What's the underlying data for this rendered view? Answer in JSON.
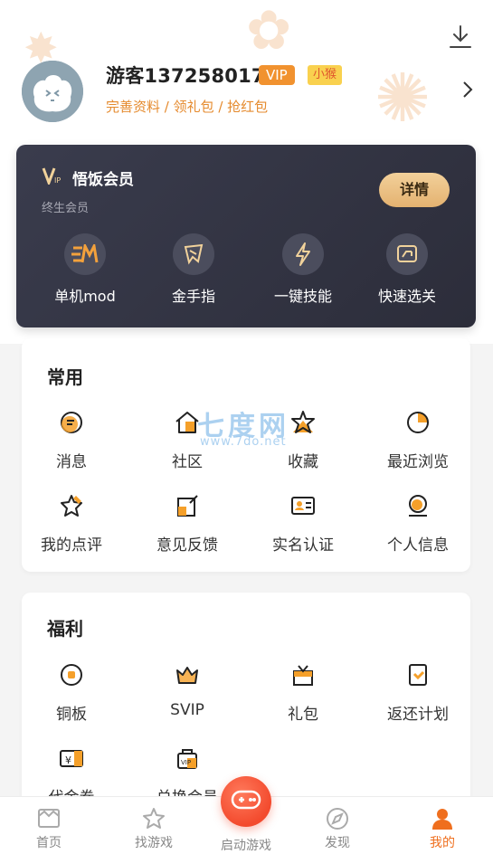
{
  "profile": {
    "username": "游客137258017",
    "vip_badge": "VIP",
    "level_badge": "小猴",
    "links": "完善资料 / 领礼包 / 抢红包"
  },
  "vip_card": {
    "title": "悟饭会员",
    "subtitle": "终生会员",
    "detail_button": "详情",
    "features": [
      {
        "label": "单机mod",
        "icon": "mod-icon"
      },
      {
        "label": "金手指",
        "icon": "cheat-icon"
      },
      {
        "label": "一键技能",
        "icon": "lightning-icon"
      },
      {
        "label": "快速选关",
        "icon": "level-select-icon"
      }
    ]
  },
  "common": {
    "title": "常用",
    "items": [
      {
        "label": "消息",
        "icon": "message-icon"
      },
      {
        "label": "社区",
        "icon": "community-icon"
      },
      {
        "label": "收藏",
        "icon": "star-icon"
      },
      {
        "label": "最近浏览",
        "icon": "history-icon"
      },
      {
        "label": "我的点评",
        "icon": "review-icon"
      },
      {
        "label": "意见反馈",
        "icon": "feedback-icon"
      },
      {
        "label": "实名认证",
        "icon": "id-card-icon"
      },
      {
        "label": "个人信息",
        "icon": "person-info-icon"
      }
    ]
  },
  "welfare": {
    "title": "福利",
    "items": [
      {
        "label": "铜板",
        "icon": "coin-icon"
      },
      {
        "label": "SVIP",
        "icon": "crown-icon"
      },
      {
        "label": "礼包",
        "icon": "gift-icon"
      },
      {
        "label": "返还计划",
        "icon": "refund-icon"
      },
      {
        "label": "代金券",
        "icon": "voucher-icon"
      },
      {
        "label": "兑换会员",
        "icon": "vip-bag-icon"
      }
    ]
  },
  "watermark": {
    "text": "七度网",
    "url": "www.7do.net"
  },
  "tabbar": {
    "tabs": [
      {
        "label": "首页",
        "icon": "home-icon"
      },
      {
        "label": "找游戏",
        "icon": "find-game-icon"
      },
      {
        "label": "启动游戏",
        "icon": "gamepad-icon"
      },
      {
        "label": "发现",
        "icon": "compass-icon"
      },
      {
        "label": "我的",
        "icon": "profile-icon"
      }
    ],
    "active_tab": "我的"
  },
  "colors": {
    "accent": "#ef6f1e",
    "vip_card_bg": "#2f3040",
    "vip_gold": "#e9bd7f"
  }
}
